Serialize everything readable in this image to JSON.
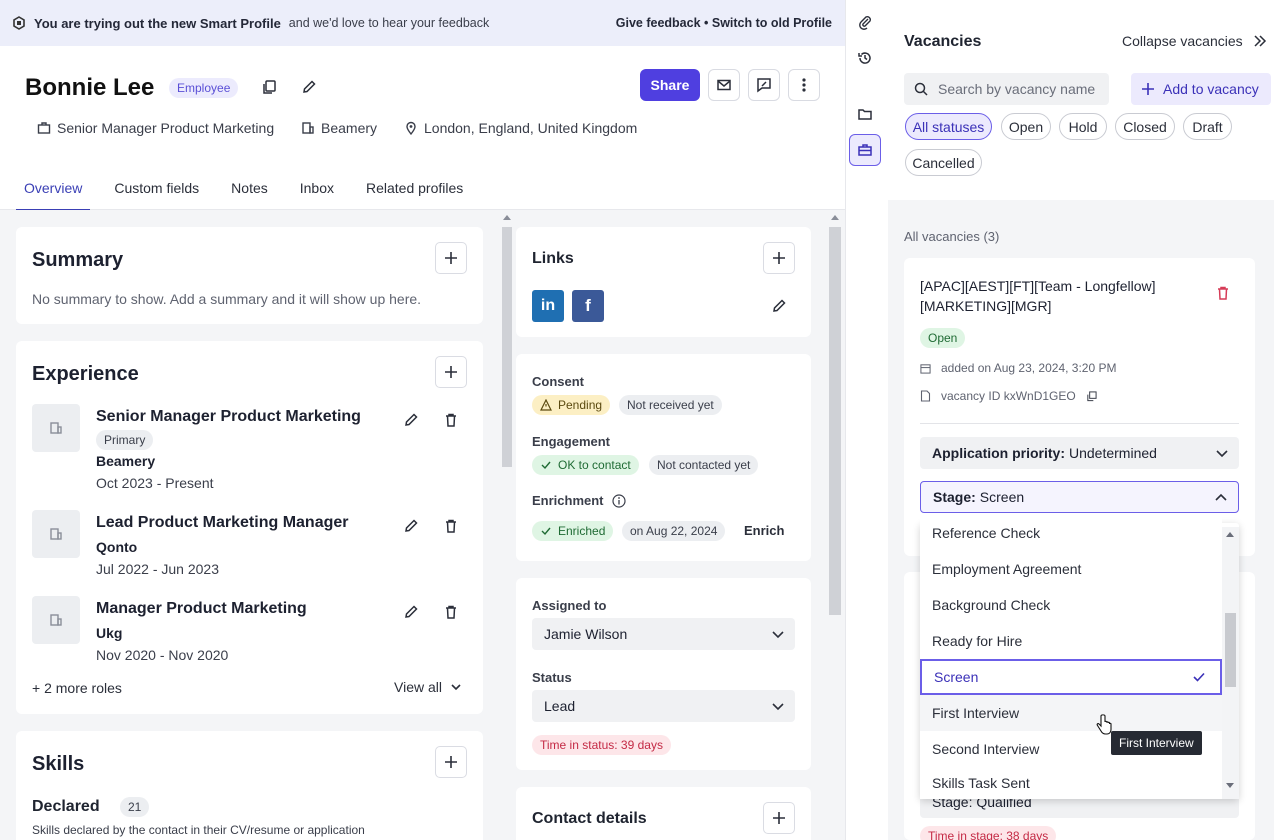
{
  "banner": {
    "title": "You are trying out the new Smart Profile",
    "subtitle": "and we'd love to hear your feedback",
    "actions": "Give feedback • Switch to old Profile"
  },
  "profile": {
    "name": "Bonnie Lee",
    "badge": "Employee",
    "share_label": "Share",
    "job_title": "Senior Manager Product Marketing",
    "company": "Beamery",
    "location": "London, England, United Kingdom"
  },
  "tabs": [
    {
      "label": "Overview"
    },
    {
      "label": "Custom fields"
    },
    {
      "label": "Notes"
    },
    {
      "label": "Inbox"
    },
    {
      "label": "Related profiles"
    }
  ],
  "summary": {
    "title": "Summary",
    "empty": "No summary to show. Add a summary and it will show up here."
  },
  "experience": {
    "title": "Experience",
    "items": [
      {
        "title": "Senior Manager Product Marketing",
        "tag": "Primary",
        "company": "Beamery",
        "dates": "Oct 2023 - Present"
      },
      {
        "title": "Lead Product Marketing Manager",
        "company": "Qonto",
        "dates": "Jul 2022 - Jun 2023"
      },
      {
        "title": "Manager Product Marketing",
        "company": "Ukg",
        "dates": "Nov 2020 - Nov 2020"
      }
    ],
    "more_roles": "+ 2 more roles",
    "view_all": "View all"
  },
  "skills": {
    "title": "Skills",
    "declared_label": "Declared",
    "declared_count": "21",
    "declared_desc": "Skills declared by the contact in their CV/resume or application"
  },
  "links": {
    "title": "Links",
    "linkedin": "in",
    "facebook": "f"
  },
  "consent": {
    "consent_label": "Consent",
    "consent_status": "Pending",
    "consent_sub": "Not received yet",
    "engagement_label": "Engagement",
    "engagement_status": "OK to contact",
    "engagement_sub": "Not contacted yet",
    "enrichment_label": "Enrichment",
    "enrichment_status": "Enriched",
    "enrichment_date": "on Aug 22, 2024",
    "enrich_action": "Enrich"
  },
  "assignment": {
    "assigned_label": "Assigned to",
    "assigned_value": "Jamie Wilson",
    "status_label": "Status",
    "status_value": "Lead",
    "time_in_status": "Time in status: 39 days"
  },
  "contact": {
    "title": "Contact details"
  },
  "vacancies": {
    "title": "Vacancies",
    "collapse": "Collapse vacancies",
    "search_placeholder": "Search by vacancy name",
    "add": "Add to vacancy",
    "statuses": [
      "All statuses",
      "Open",
      "Hold",
      "Closed",
      "Draft",
      "Cancelled"
    ],
    "all_label": "All vacancies (3)",
    "vacancy": {
      "name_line1": "[APAC][AEST][FT][Team - Longfellow]",
      "name_line2": "[MARKETING][MGR]",
      "status": "Open",
      "added": "added on Aug 23, 2024, 3:20 PM",
      "vacancy_id": "vacancy ID kxWnD1GEO",
      "priority_label": "Application priority:",
      "priority_value": "Undetermined",
      "stage_label": "Stage:",
      "stage_value": "Screen"
    },
    "dropdown": [
      "Reference Check",
      "Employment Agreement",
      "Background Check",
      "Ready for Hire",
      "Screen",
      "First Interview",
      "Second Interview",
      "Skills Task Sent"
    ],
    "tooltip": "First Interview",
    "under_stage": "Stage: Qualified",
    "time_in_stage": "Time in stage: 38 days"
  },
  "colors": {
    "accent": "#4f3fe0",
    "tab_active": "#3a3fb5",
    "delete": "#d63b57"
  }
}
